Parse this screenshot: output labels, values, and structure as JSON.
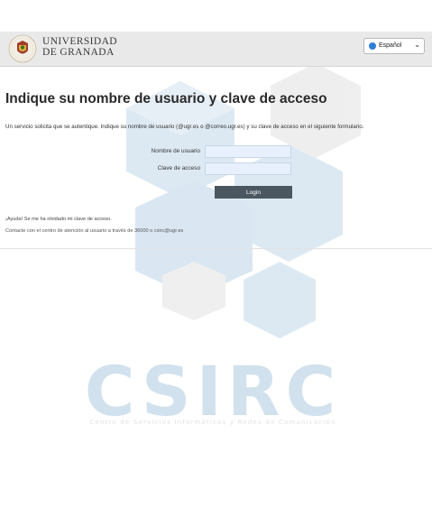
{
  "header": {
    "university_line1": "UNIVERSIDAD",
    "university_line2": "DE GRANADA",
    "language": {
      "selected": "Español",
      "flag_icon": "globe-icon",
      "chevron_icon": "chevron-down-icon"
    }
  },
  "main": {
    "title": "Indique su nombre de usuario y clave de acceso",
    "intro": "Un servicio solicita que se autentique. Indique su nombre de usuario (@ugr.es o @correo.ugr.es) y su clave de acceso en el siguiente formulario.",
    "form": {
      "username_label": "Nombre de usuario",
      "username_value": "",
      "password_label": "Clave de acceso",
      "password_value": "",
      "login_label": "Login"
    },
    "help": "¡Ayuda! Se me ha olvidado mi clave de acceso.",
    "contact": "Contacte con el centro de atención al usuario a través de 36000 o csirc@ugr.es"
  },
  "watermark": {
    "brand": "CSIRC",
    "tagline": "Centro de Servicios Informáticos y Redes de Comunicación"
  },
  "colors": {
    "watermark_blue": "#c9dcea",
    "watermark_gray": "#e6e6e6",
    "button": "#4a5660",
    "header_bg": "#e9e9e9"
  }
}
